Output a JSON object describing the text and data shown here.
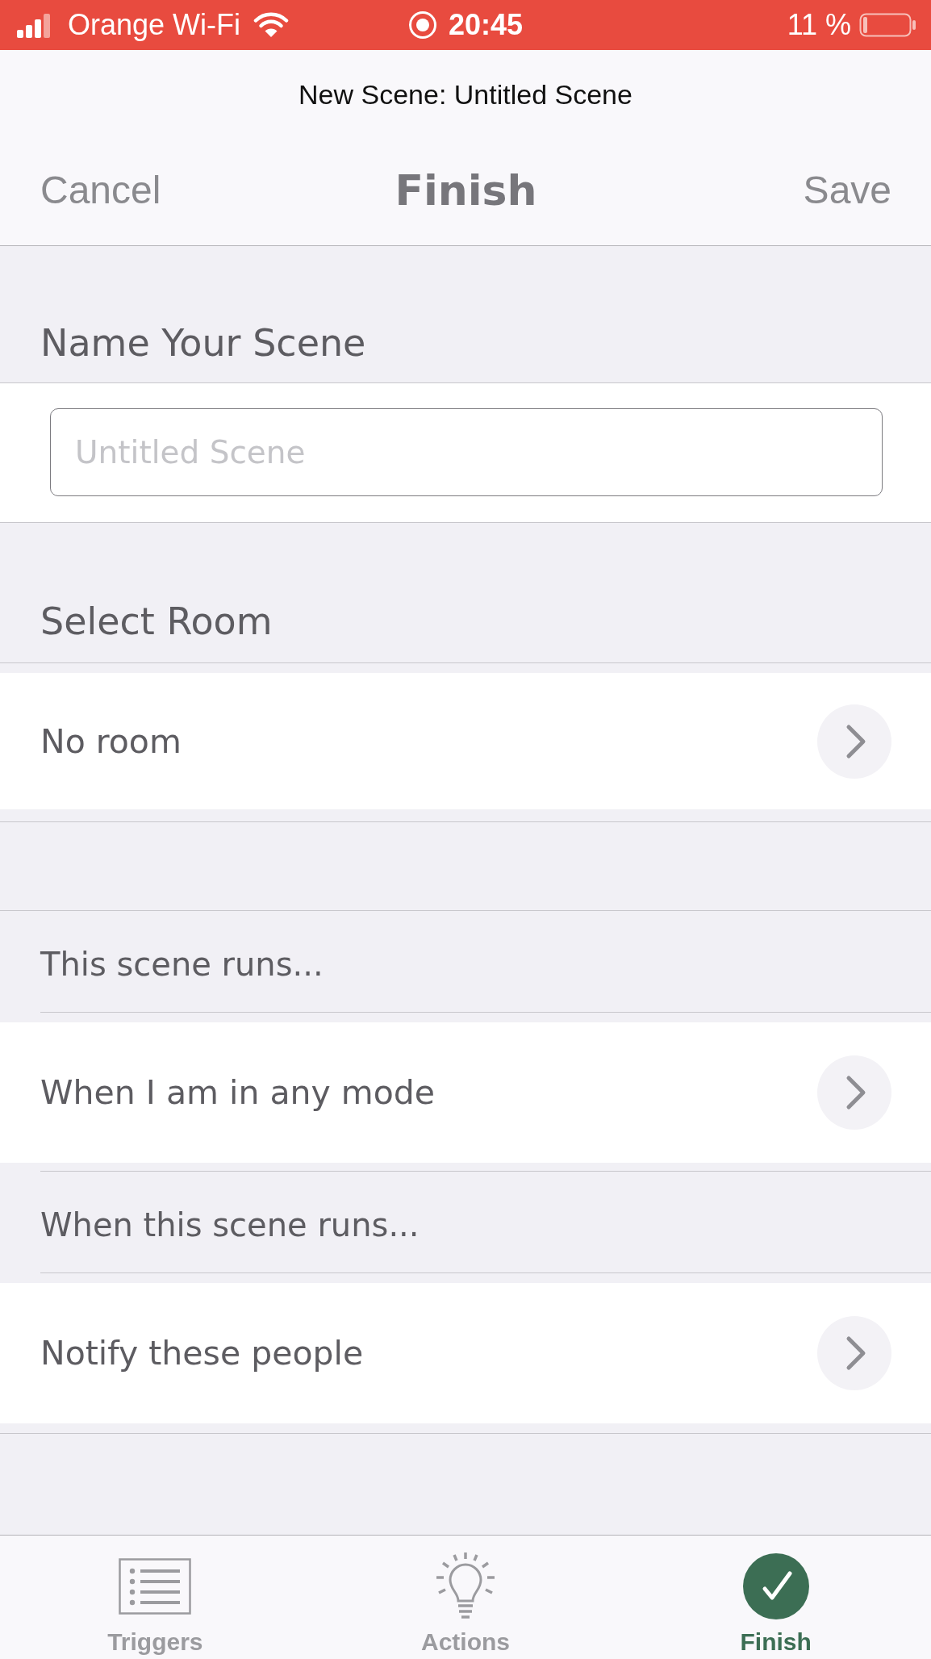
{
  "status_bar": {
    "carrier": "Orange Wi-Fi",
    "time": "20:45",
    "battery": "11 %"
  },
  "nav": {
    "subtitle": "New Scene: Untitled Scene",
    "cancel": "Cancel",
    "title": "Finish",
    "save": "Save"
  },
  "name_section": {
    "header": "Name Your Scene",
    "field": {
      "placeholder": "Untitled Scene"
    }
  },
  "room_section": {
    "header": "Select Room",
    "row": "No room"
  },
  "option_sections": [
    {
      "header": "This scene runs...",
      "row": "When I am in any mode"
    },
    {
      "header": "When this scene runs...",
      "row": "Notify these people"
    }
  ],
  "tab_bar": [
    {
      "label": "Triggers",
      "selected": false
    },
    {
      "label": "Actions",
      "selected": false
    },
    {
      "label": "Finish",
      "selected": true
    }
  ]
}
